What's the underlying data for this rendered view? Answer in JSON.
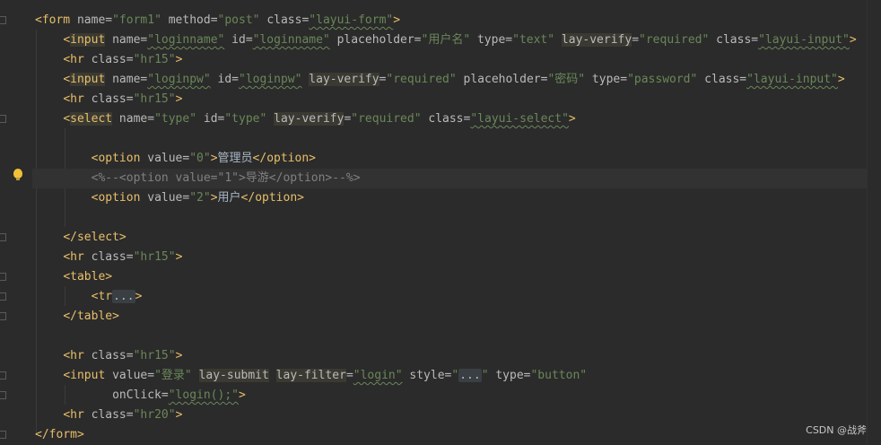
{
  "editor": {
    "lines": [
      {
        "segs": [
          [
            "t",
            "<form"
          ],
          [
            "a",
            " name="
          ],
          [
            "v",
            "\"form1\""
          ],
          [
            "a",
            " method="
          ],
          [
            "v",
            "\"post\""
          ],
          [
            "a",
            " class="
          ],
          [
            "v",
            "\"layui-form\""
          ],
          [
            "t",
            ">"
          ]
        ]
      },
      {
        "segs": [
          [
            "t",
            "<"
          ],
          [
            "hl",
            "input"
          ],
          [
            "a",
            " name="
          ],
          [
            "v",
            "\"loginname\""
          ],
          [
            "a",
            " id="
          ],
          [
            "v",
            "\"loginname\""
          ],
          [
            "a",
            " placeholder="
          ],
          [
            "v",
            "\"用户名\""
          ],
          [
            "a",
            " type="
          ],
          [
            "v",
            "\"text\""
          ],
          [
            "a",
            " "
          ],
          [
            "ha",
            "lay-verify"
          ],
          [
            "a",
            "="
          ],
          [
            "v",
            "\"required\""
          ],
          [
            "a",
            " class="
          ],
          [
            "v",
            "\"layui-input\""
          ],
          [
            "t",
            ">"
          ]
        ]
      },
      {
        "segs": [
          [
            "t",
            "<hr"
          ],
          [
            "a",
            " class="
          ],
          [
            "v",
            "\"hr15\""
          ],
          [
            "t",
            ">"
          ]
        ]
      },
      {
        "segs": [
          [
            "t",
            "<"
          ],
          [
            "hl",
            "input"
          ],
          [
            "a",
            " name="
          ],
          [
            "v",
            "\"loginpw\""
          ],
          [
            "a",
            " id="
          ],
          [
            "v",
            "\"loginpw\""
          ],
          [
            "a",
            " "
          ],
          [
            "ha",
            "lay-verify"
          ],
          [
            "a",
            "="
          ],
          [
            "v",
            "\"required\""
          ],
          [
            "a",
            " placeholder="
          ],
          [
            "v",
            "\"密码\""
          ],
          [
            "a",
            " type="
          ],
          [
            "v",
            "\"password\""
          ],
          [
            "a",
            " class="
          ],
          [
            "v",
            "\"layui-input\""
          ],
          [
            "t",
            ">"
          ]
        ]
      },
      {
        "segs": [
          [
            "t",
            "<hr"
          ],
          [
            "a",
            " class="
          ],
          [
            "v",
            "\"hr15\""
          ],
          [
            "t",
            ">"
          ]
        ]
      },
      {
        "segs": [
          [
            "t",
            "<"
          ],
          [
            "hl",
            "select"
          ],
          [
            "a",
            " name="
          ],
          [
            "v",
            "\"type\""
          ],
          [
            "a",
            " id="
          ],
          [
            "v",
            "\"type\""
          ],
          [
            "a",
            " "
          ],
          [
            "ha",
            "lay-verify"
          ],
          [
            "a",
            "="
          ],
          [
            "v",
            "\"required\""
          ],
          [
            "a",
            " class="
          ],
          [
            "v",
            "\"layui-select\""
          ],
          [
            "t",
            ">"
          ]
        ]
      },
      {
        "segs": []
      },
      {
        "segs": [
          [
            "t",
            "<option"
          ],
          [
            "a",
            " value="
          ],
          [
            "v",
            "\"0\""
          ],
          [
            "t",
            ">"
          ],
          [
            "x",
            "管理员"
          ],
          [
            "t",
            "</option>"
          ]
        ]
      },
      {
        "segs": [
          [
            "c",
            "<%--<option value=\"1\">导游</option>--%>"
          ]
        ]
      },
      {
        "segs": [
          [
            "t",
            "<option"
          ],
          [
            "a",
            " value="
          ],
          [
            "v",
            "\"2\""
          ],
          [
            "t",
            ">"
          ],
          [
            "x",
            "用户"
          ],
          [
            "t",
            "</option>"
          ]
        ]
      },
      {
        "segs": []
      },
      {
        "segs": [
          [
            "t",
            "</select>"
          ]
        ]
      },
      {
        "segs": [
          [
            "t",
            "<hr"
          ],
          [
            "a",
            " class="
          ],
          [
            "v",
            "\"hr15\""
          ],
          [
            "t",
            ">"
          ]
        ]
      },
      {
        "segs": [
          [
            "t",
            "<table>"
          ]
        ]
      },
      {
        "segs": [
          [
            "t",
            "<tr"
          ],
          [
            "fold",
            "..."
          ],
          [
            "t",
            ">"
          ]
        ]
      },
      {
        "segs": [
          [
            "t",
            "</table>"
          ]
        ]
      },
      {
        "segs": []
      },
      {
        "segs": [
          [
            "t",
            "<hr"
          ],
          [
            "a",
            " class="
          ],
          [
            "v",
            "\"hr15\""
          ],
          [
            "t",
            ">"
          ]
        ]
      },
      {
        "segs": [
          [
            "t",
            "<input"
          ],
          [
            "a",
            " value="
          ],
          [
            "v",
            "\"登录\""
          ],
          [
            "a",
            " "
          ],
          [
            "ha",
            "lay-submit"
          ],
          [
            "a",
            " "
          ],
          [
            "ha",
            "lay-filter"
          ],
          [
            "a",
            "="
          ],
          [
            "v",
            "\"login\""
          ],
          [
            "a",
            " style="
          ],
          [
            "v",
            "\""
          ],
          [
            "fold",
            "..."
          ],
          [
            "v",
            "\""
          ],
          [
            "a",
            " type="
          ],
          [
            "v",
            "\"button\""
          ]
        ]
      },
      {
        "segs": [
          [
            "a",
            "onClick="
          ],
          [
            "v",
            "\"login();\""
          ],
          [
            "t",
            ">"
          ]
        ]
      },
      {
        "segs": [
          [
            "t",
            "<hr"
          ],
          [
            "a",
            " class="
          ],
          [
            "v",
            "\"hr20\""
          ],
          [
            "t",
            ">"
          ]
        ]
      },
      {
        "segs": [
          [
            "t",
            "</form>"
          ]
        ]
      }
    ]
  },
  "footer": {
    "watermark": "CSDN @战斧"
  },
  "colors": {
    "background": "#2b2b2b",
    "tag": "#e8bf6a",
    "attribute": "#bababa",
    "string": "#6a8759",
    "comment": "#808080",
    "text": "#a9b7c6"
  },
  "icons": {
    "intention": "lightbulb-icon"
  }
}
